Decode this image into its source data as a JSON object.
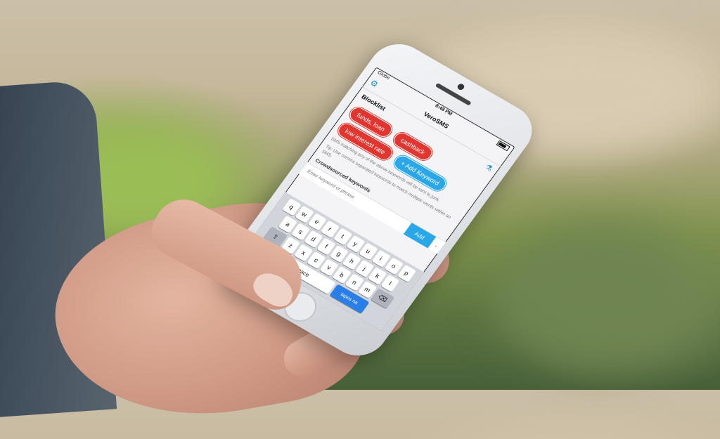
{
  "status": {
    "carrier": "Globe",
    "time": "8:48 PM"
  },
  "nav": {
    "title": "VeroSMS",
    "settings_icon": "gear-icon",
    "flask_icon": "flask-icon"
  },
  "blocklist": {
    "title": "Blocklist",
    "keywords": [
      "funds, loan",
      "cashback",
      "low interest rate"
    ],
    "add_label": "+ Add Keyword"
  },
  "help": {
    "line1": "SMS matching any of the above keywords will be sent to junk.",
    "line2": "Tip: Use comma separated keywords to match multiple words within an SMS."
  },
  "crowd": {
    "title": "Crowdsourced keywords"
  },
  "input": {
    "placeholder": "Enter keyword or phrase",
    "add_label": "Add"
  },
  "keyboard": {
    "row1": [
      "q",
      "w",
      "e",
      "r",
      "t",
      "y",
      "u",
      "i",
      "o",
      "p"
    ],
    "row2": [
      "a",
      "s",
      "d",
      "f",
      "g",
      "h",
      "j",
      "k",
      "l"
    ],
    "row3": [
      "z",
      "x",
      "c",
      "v",
      "b",
      "n",
      "m"
    ],
    "shift": "⇧",
    "delete": "⌫",
    "space": "space",
    "go": "tapos na"
  },
  "colors": {
    "accent": "#2aa7e8",
    "chip_red": "#e0362f"
  }
}
